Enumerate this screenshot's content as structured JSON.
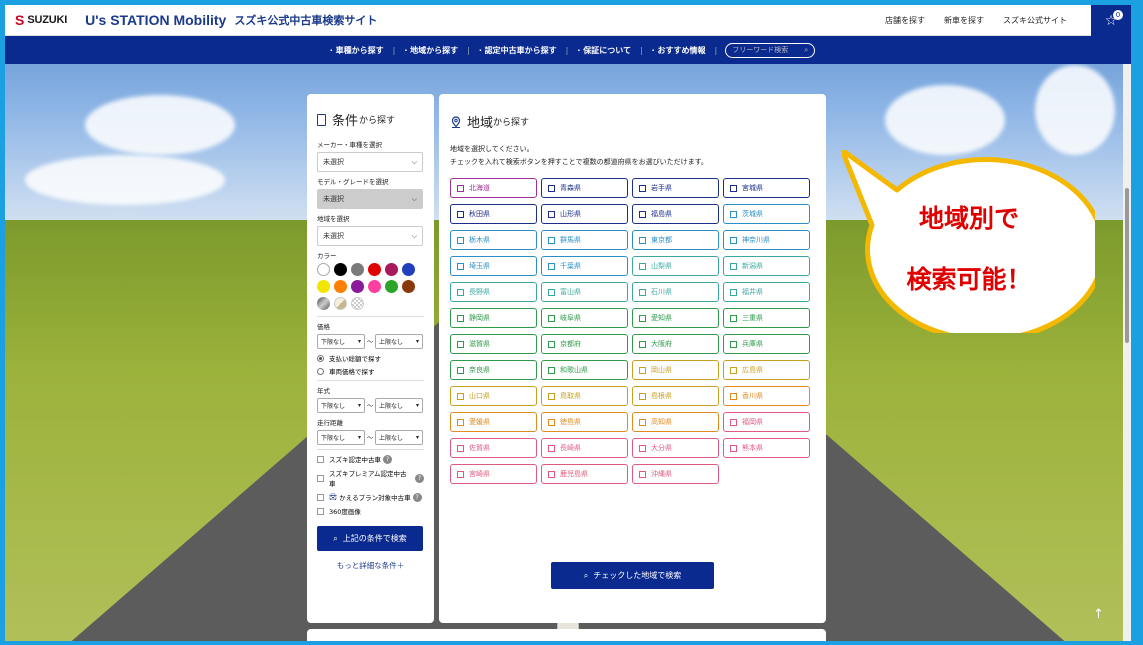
{
  "header": {
    "logo_mark": "S",
    "logo_text": "SUZUKI",
    "brand": "U's STATION Mobility",
    "site_title": "スズキ公式中古車検索サイト",
    "links": [
      "店舗を探す",
      "新車を探す",
      "スズキ公式サイト"
    ],
    "cart_count": "0"
  },
  "nav": {
    "items": [
      "車種から探す",
      "地域から探す",
      "認定中古車から探す",
      "保証について",
      "おすすめ情報"
    ],
    "search_placeholder": "フリーワード検索"
  },
  "left": {
    "title": "条件",
    "title_suffix": "から探す",
    "maker_label": "メーカー・車種を選択",
    "maker_value": "未選択",
    "model_label": "モデル・グレードを選択",
    "model_value": "未選択",
    "region_label": "地域を選択",
    "region_value": "未選択",
    "color_label": "カラー",
    "colors": [
      "#ffffff",
      "#000000",
      "#7a7a7a",
      "#e00000",
      "#a8185c",
      "#1f3fbf",
      "#f2e600",
      "#ff7f00",
      "#8a1a9a",
      "#ff3fa0",
      "#2aa52a",
      "#8a3a0a",
      "#888888",
      "#e8e0c0",
      "#d8d8d8"
    ],
    "price_label": "価格",
    "min_none": "下限なし",
    "max_none": "上限なし",
    "tilde": "〜",
    "pay_total": "支払い総額で探す",
    "vehicle_price": "車両価格で探す",
    "year_label": "年式",
    "mileage_label": "走行距離",
    "checks": [
      "スズキ認定中古車",
      "スズキプレミアム認定中古車",
      "かえるプラン対象中古車",
      "360度画像"
    ],
    "search_btn": "上記の条件で検索",
    "more": "もっと詳細な条件＋"
  },
  "right": {
    "title": "地域",
    "title_suffix": "から探す",
    "desc1": "地域を選択してください。",
    "desc2": "チェックを入れて検索ボタンを押すことで複数の都道府県をお選びいただけます。",
    "prefectures": [
      {
        "name": "北海道",
        "color": "#a0309a"
      },
      {
        "name": "青森県",
        "color": "#1a2e8a"
      },
      {
        "name": "岩手県",
        "color": "#1a2e8a"
      },
      {
        "name": "宮城県",
        "color": "#1a2e8a"
      },
      {
        "name": "秋田県",
        "color": "#1a2e8a"
      },
      {
        "name": "山形県",
        "color": "#1a2e8a"
      },
      {
        "name": "福島県",
        "color": "#1a2e8a"
      },
      {
        "name": "茨城県",
        "color": "#2a8fc8"
      },
      {
        "name": "栃木県",
        "color": "#2a8fc8"
      },
      {
        "name": "群馬県",
        "color": "#2a8fc8"
      },
      {
        "name": "東京都",
        "color": "#2a8fc8"
      },
      {
        "name": "神奈川県",
        "color": "#2a8fc8"
      },
      {
        "name": "埼玉県",
        "color": "#2a8fc8"
      },
      {
        "name": "千葉県",
        "color": "#2a8fc8"
      },
      {
        "name": "山梨県",
        "color": "#3aa8a0"
      },
      {
        "name": "新潟県",
        "color": "#3aa8a0"
      },
      {
        "name": "長野県",
        "color": "#3aa8a0"
      },
      {
        "name": "富山県",
        "color": "#3aa8a0"
      },
      {
        "name": "石川県",
        "color": "#3aa8a0"
      },
      {
        "name": "福井県",
        "color": "#3aa8a0"
      },
      {
        "name": "静岡県",
        "color": "#2e9a4a"
      },
      {
        "name": "岐阜県",
        "color": "#2e9a4a"
      },
      {
        "name": "愛知県",
        "color": "#2e9a4a"
      },
      {
        "name": "三重県",
        "color": "#2e9a4a"
      },
      {
        "name": "滋賀県",
        "color": "#2e9a4a"
      },
      {
        "name": "京都府",
        "color": "#2e9a4a"
      },
      {
        "name": "大阪府",
        "color": "#2e9a4a"
      },
      {
        "name": "兵庫県",
        "color": "#2e9a4a"
      },
      {
        "name": "奈良県",
        "color": "#2e9a4a"
      },
      {
        "name": "和歌山県",
        "color": "#2e9a4a"
      },
      {
        "name": "岡山県",
        "color": "#c8a020"
      },
      {
        "name": "広島県",
        "color": "#c8a020"
      },
      {
        "name": "山口県",
        "color": "#c8a020"
      },
      {
        "name": "鳥取県",
        "color": "#c8a020"
      },
      {
        "name": "島根県",
        "color": "#c8a020"
      },
      {
        "name": "香川県",
        "color": "#e08a20"
      },
      {
        "name": "愛媛県",
        "color": "#e08a20"
      },
      {
        "name": "徳島県",
        "color": "#e08a20"
      },
      {
        "name": "高知県",
        "color": "#e08a20"
      },
      {
        "name": "福岡県",
        "color": "#e05a80"
      },
      {
        "name": "佐賀県",
        "color": "#e05a80"
      },
      {
        "name": "長崎県",
        "color": "#e05a80"
      },
      {
        "name": "大分県",
        "color": "#e05a80"
      },
      {
        "name": "熊本県",
        "color": "#e05a80"
      },
      {
        "name": "宮崎県",
        "color": "#e05a80"
      },
      {
        "name": "鹿児島県",
        "color": "#e05a80"
      },
      {
        "name": "沖縄県",
        "color": "#e05a80"
      }
    ],
    "search_btn": "チェックした地域で検索"
  },
  "callout": {
    "line1": "地域別で",
    "line2": "検索可能！"
  }
}
